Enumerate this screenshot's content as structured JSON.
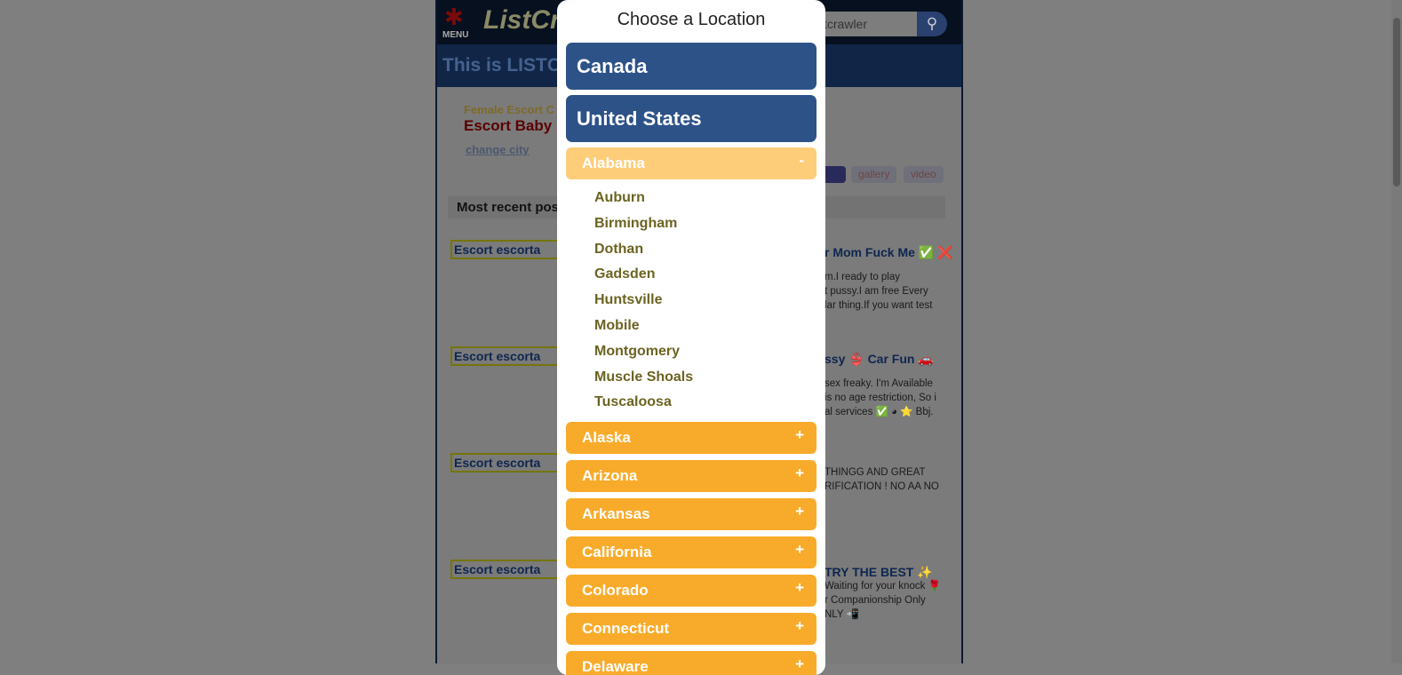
{
  "background": {
    "menu_label": "MENU",
    "logo_text": "ListCraw",
    "search_value": "stcrawler",
    "banner": "This is LISTC",
    "category": "Female Escort C",
    "city_title": "Escort Baby",
    "change_city": "change city",
    "tags": [
      "gallery",
      "video"
    ],
    "recent_header": "Most recent pos",
    "listings": [
      {
        "thumb": "Escort escorta",
        "title": "r Mom Fuck Me ✅ ❌",
        "text": "m.I ready to play\nt pussy.I am free Every\nlar thing.If you want test"
      },
      {
        "thumb": "Escort escorta",
        "title": "ssy 👙 Car Fun 🚗",
        "text": "sex freaky. I'm Available\nis no age restriction, So i\nal services ✅ ◕ ⭐ Bbj."
      },
      {
        "thumb": "Escort escorta",
        "title": "",
        "text": "THINGG AND GREAT\nRIFICATION ! NO AA NO"
      },
      {
        "thumb": "Escort escorta",
        "title": "TRY THE BEST ✨",
        "text": "Waiting for your knock 🌹\nr Companionship Only\nNLY 📲"
      }
    ]
  },
  "modal": {
    "title": "Choose a Location",
    "countries": [
      "Canada",
      "United States"
    ],
    "open_state": {
      "name": "Alabama",
      "sign": "-",
      "cities": [
        "Auburn",
        "Birmingham",
        "Dothan",
        "Gadsden",
        "Huntsville",
        "Mobile",
        "Montgomery",
        "Muscle Shoals",
        "Tuscaloosa"
      ]
    },
    "states": [
      "Alaska",
      "Arizona",
      "Arkansas",
      "California",
      "Colorado",
      "Connecticut",
      "Delaware"
    ],
    "collapsed_sign": "+"
  },
  "colors": {
    "country": "#2d5288",
    "state": "#f8ab2a",
    "state_open": "#fdcd7a",
    "city": "#6b6421"
  }
}
